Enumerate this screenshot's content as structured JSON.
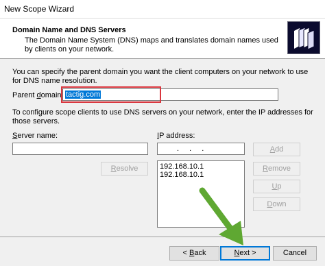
{
  "window": {
    "title": "New Scope Wizard"
  },
  "header": {
    "title": "Domain Name and DNS Servers",
    "description": "The Domain Name System (DNS) maps and translates domain names used by clients on your network.",
    "icon": "directory-folder-icon"
  },
  "intro_text": "You can specify the parent domain you want the client computers on your network to use for DNS name resolution.",
  "parent_domain": {
    "label_pre": "Parent ",
    "label_u": "d",
    "label_post": "omain:",
    "value": "tactig.com"
  },
  "scope_text": "To configure scope clients to use DNS servers on your network, enter the IP addresses for those servers.",
  "server_name": {
    "label_pre": "",
    "label_u": "S",
    "label_post": "erver name:",
    "value": ""
  },
  "ip_address": {
    "label_pre": "",
    "label_u": "I",
    "label_post": "P address:",
    "value": ". . ."
  },
  "buttons": {
    "resolve": {
      "pre": "",
      "u": "R",
      "post": "esolve"
    },
    "add": {
      "pre": "",
      "u": "A",
      "post": "dd"
    },
    "remove": {
      "pre": "",
      "u": "R",
      "post": "emove"
    },
    "up": {
      "pre": "",
      "u": "U",
      "post": "p"
    },
    "down": {
      "pre": "",
      "u": "D",
      "post": "own"
    }
  },
  "ip_list": [
    "192.168.10.1",
    "192.168.10.1"
  ],
  "footer": {
    "back": {
      "pre": "< ",
      "u": "B",
      "post": "ack"
    },
    "next": {
      "pre": "",
      "u": "N",
      "post": "ext >"
    },
    "cancel": "Cancel"
  },
  "colors": {
    "highlight": "#d9363e",
    "arrow": "#5fa832",
    "selection": "#0078d7"
  }
}
